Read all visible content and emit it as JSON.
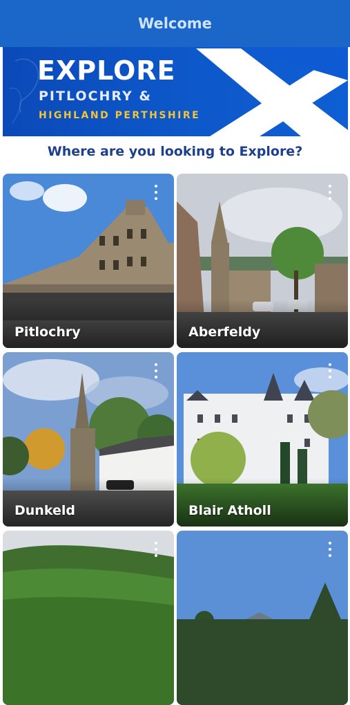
{
  "header": {
    "title": "Welcome"
  },
  "banner": {
    "title": "EXPLORE",
    "subtitle_line1": "PITLOCHRY &",
    "subtitle_line2": "HIGHLAND PERTHSHIRE"
  },
  "prompt": "Where are you looking to Explore?",
  "colors": {
    "header_bg": "#1a66c9",
    "banner_bg": "#0d56c8",
    "accent_gold": "#f3c533",
    "prompt_text": "#1d3f8e"
  },
  "locations": [
    {
      "label": "Pitlochry",
      "menu_icon": "more-vert-icon"
    },
    {
      "label": "Aberfeldy",
      "menu_icon": "more-vert-icon"
    },
    {
      "label": "Dunkeld",
      "menu_icon": "more-vert-icon"
    },
    {
      "label": "Blair Atholl",
      "menu_icon": "more-vert-icon"
    },
    {
      "label": "",
      "menu_icon": "more-vert-icon"
    },
    {
      "label": "",
      "menu_icon": "more-vert-icon"
    }
  ]
}
